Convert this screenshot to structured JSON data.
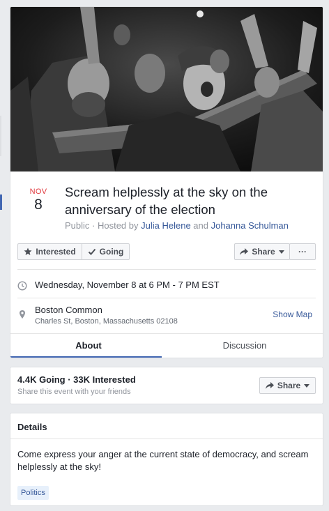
{
  "event": {
    "cover_alt": "Crowd screaming at the sky",
    "date_month": "NOV",
    "date_day": "8",
    "title": "Scream helplessly at the sky on the anniversary of the election",
    "privacy": "Public",
    "hosted_by_prefix": " · Hosted by ",
    "host_1": "Julia Helene",
    "host_joiner": " and ",
    "host_2": "Johanna Schulman"
  },
  "actions": {
    "interested_label": "Interested",
    "going_label": "Going",
    "share_label": "Share",
    "more_label": "···"
  },
  "time": {
    "text": "Wednesday, November 8 at 6 PM - 7 PM EST"
  },
  "location": {
    "name": "Boston Common",
    "address": "Charles St, Boston, Massachusetts 02108",
    "show_map_label": "Show Map"
  },
  "tabs": [
    {
      "label": "About",
      "active": true
    },
    {
      "label": "Discussion",
      "active": false
    }
  ],
  "stats": {
    "summary": "4.4K Going · 33K Interested",
    "subtext": "Share this event with your friends",
    "share_label": "Share"
  },
  "details": {
    "title": "Details",
    "description": "Come express your anger at the current state of democracy, and scream helplessly at the sky!",
    "tag": "Politics"
  },
  "colors": {
    "accent": "#4267b2",
    "link": "#365899",
    "month": "#e0393e"
  }
}
